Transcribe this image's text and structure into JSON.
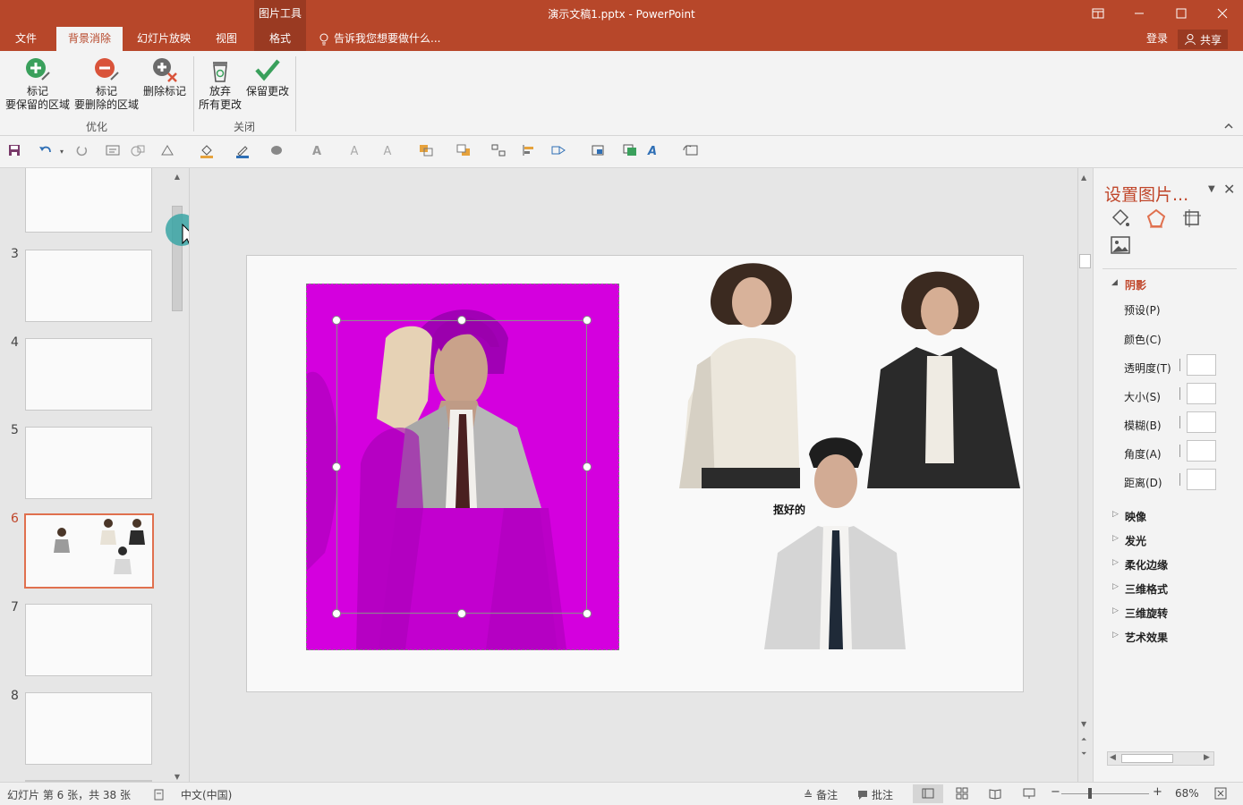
{
  "window": {
    "title": "演示文稿1.pptx - PowerPoint",
    "context_group": "图片工具",
    "controls": [
      "restore-ribbon",
      "minimize",
      "maximize",
      "close"
    ]
  },
  "tabs": [
    {
      "label": "文件"
    },
    {
      "label": "背景消除",
      "active": true
    },
    {
      "label": "幻灯片放映"
    },
    {
      "label": "视图"
    },
    {
      "label": "格式"
    }
  ],
  "tell_me": "告诉我您想要做什么...",
  "account": {
    "signin": "登录",
    "share": "共享"
  },
  "ribbon": {
    "groups": [
      {
        "label": "优化",
        "buttons": [
          {
            "line1": "标记",
            "line2": "要保留的区域",
            "icon": "mark-keep-icon"
          },
          {
            "line1": "标记",
            "line2": "要删除的区域",
            "icon": "mark-remove-icon"
          },
          {
            "line1": "删除标记",
            "line2": "",
            "icon": "delete-mark-icon"
          }
        ]
      },
      {
        "label": "关闭",
        "buttons": [
          {
            "line1": "放弃",
            "line2": "所有更改",
            "icon": "discard-icon"
          },
          {
            "line1": "保留更改",
            "line2": "",
            "icon": "keep-changes-icon"
          }
        ]
      }
    ]
  },
  "slides": {
    "visible_numbers": [
      "3",
      "4",
      "5",
      "6",
      "7",
      "8"
    ],
    "active": "6"
  },
  "slide_content": {
    "caption": "抠好的"
  },
  "pane": {
    "title": "设置图片...",
    "open_section": "阴影",
    "shadow_rows": [
      {
        "label": "预设(P)"
      },
      {
        "label": "颜色(C)"
      },
      {
        "label": "透明度(T)",
        "has_input": true
      },
      {
        "label": "大小(S)",
        "has_input": true
      },
      {
        "label": "模糊(B)",
        "has_input": true
      },
      {
        "label": "角度(A)",
        "has_input": true
      },
      {
        "label": "距离(D)",
        "has_input": true
      }
    ],
    "collapsed_sections": [
      "映像",
      "发光",
      "柔化边缘",
      "三维格式",
      "三维旋转",
      "艺术效果"
    ]
  },
  "status": {
    "slide_info": "幻灯片 第 6 张，共 38 张",
    "language": "中文(中国)",
    "notes": "备注",
    "comments": "批注",
    "zoom": "68%"
  },
  "colors": {
    "accent": "#b7472a",
    "removal_overlay": "#e000e8",
    "selection_active": "#e0704e"
  }
}
